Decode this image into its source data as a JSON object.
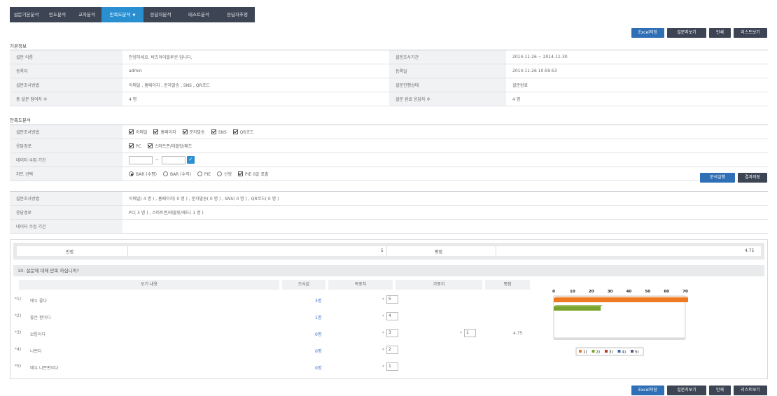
{
  "tabs": [
    {
      "label": "설문기본분석",
      "active": false
    },
    {
      "label": "빈도분석",
      "active": false
    },
    {
      "label": "교차분석",
      "active": false
    },
    {
      "label": "만족도분석",
      "active": true
    },
    {
      "label": "응답자분석",
      "active": false
    },
    {
      "label": "테스트분석",
      "active": false
    },
    {
      "label": "응답자추정",
      "active": false
    }
  ],
  "toolbar": {
    "excel": "Excel저장",
    "view_survey": "설문지보기",
    "print": "인쇄",
    "list_view": "리스트보기"
  },
  "basic": {
    "title": "기본정보",
    "survey_name_label": "설문 이름",
    "survey_name": "안녕하세요. 비즈아이블루션 입니다.",
    "period_label": "설문조사기간",
    "period": "2014-11-26 ~ 2014-11-30",
    "registrant_label": "등록자",
    "registrant": "admin",
    "reg_date_label": "등록일",
    "reg_date": "2014-11-26 10:59:53",
    "method_label": "설문조사방법",
    "method": "이메일 , 홈페이지 , 문자발송 , SNS , QR코드",
    "status_label": "설문진행상태",
    "status": "설문완료",
    "participants_label": "총 설문 참여자 수",
    "participants": "4 명",
    "completed_label": "설문 완료 응답자 수",
    "completed": "4 명"
  },
  "analysis": {
    "title": "만족도분석",
    "method_label": "설문조사방법",
    "methods": [
      "이메일",
      "홈페이지",
      "문자발송",
      "SNS",
      "QR코드"
    ],
    "channel_label": "응답경로",
    "channels": [
      "PC",
      "스마트폰/태블릿/패드"
    ],
    "period_label": "데이터 수집 기간",
    "period_sep": "~",
    "chart_label": "차트 선택",
    "chart_options": [
      "BAR (수평)",
      "BAR (수직)",
      "PIE",
      "선형"
    ],
    "pie_option": "PIE 0값 표출",
    "run_button": "분석실행",
    "save_button": "결과저장"
  },
  "summary_info": {
    "method_label": "설문조사방법",
    "method": "이메일( 4 명 ) , 홈페이지( 0 명 ) , 문자발송( 0 명 ) , SNS( 0 명 ) , QR코드( 0 명 )",
    "channel_label": "응답경로",
    "channel": "PC( 3 명 ) , 스마트폰/태블릿/패드( 1 명 )",
    "period_label": "데이터 수집 기간",
    "period": ""
  },
  "result": {
    "total_label": "만점",
    "total_value": "5",
    "avg_label": "평점",
    "avg_value": "4.75",
    "question": "10. 설문에 대해 만족 하십니까?",
    "headers": {
      "item": "보기 내용",
      "count": "조사값",
      "target": "목표치",
      "weight": "가중치",
      "score": "평점"
    },
    "rows": [
      {
        "num": "1)",
        "text": "매우 좋다",
        "count": "3명",
        "target": "5"
      },
      {
        "num": "2)",
        "text": "좋은 편이다",
        "count": "1명",
        "target": "4"
      },
      {
        "num": "3)",
        "text": "보통이다",
        "count": "0명",
        "target": "3"
      },
      {
        "num": "4)",
        "text": "나쁘다",
        "count": "0명",
        "target": "2"
      },
      {
        "num": "5)",
        "text": "매우 나쁜편이다",
        "count": "0명",
        "target": "1"
      }
    ],
    "weight_value": "1",
    "score_value": "4.75"
  },
  "chart_data": {
    "type": "bar",
    "orientation": "horizontal",
    "categories": [
      "1)",
      "2)",
      "3)",
      "4)",
      "5)"
    ],
    "values": [
      75,
      25,
      0,
      0,
      0
    ],
    "xlim": [
      0,
      70
    ],
    "xticks": [
      "0",
      "10",
      "20",
      "30",
      "40",
      "50",
      "60",
      "70"
    ],
    "colors": [
      "#f07a22",
      "#79a52f",
      "#c0382b",
      "#3e6ab0",
      "#6a4c93"
    ],
    "legend_position": "bottom",
    "legend": [
      "1)",
      "2)",
      "3)",
      "4)",
      "5)"
    ]
  }
}
